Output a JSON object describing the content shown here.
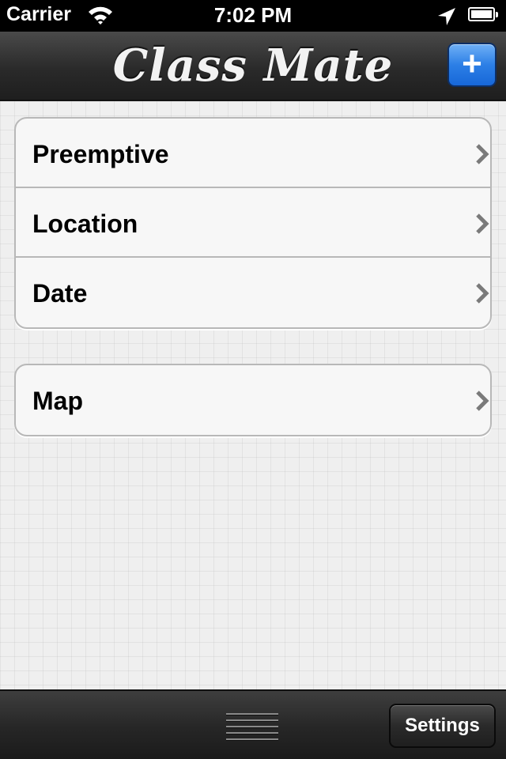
{
  "status_bar": {
    "carrier": "Carrier",
    "time": "7:02 PM",
    "icons": [
      "wifi-icon",
      "location-arrow-icon",
      "battery-icon"
    ]
  },
  "nav_bar": {
    "title": "Class Mate",
    "add_button_label": "+"
  },
  "groups": [
    {
      "rows": [
        {
          "label": "Preemptive",
          "icon": "chevron-right-icon"
        },
        {
          "label": "Location",
          "icon": "chevron-right-icon"
        },
        {
          "label": "Date",
          "icon": "chevron-right-icon"
        }
      ]
    },
    {
      "rows": [
        {
          "label": "Map",
          "icon": "chevron-right-icon"
        }
      ]
    }
  ],
  "tab_bar": {
    "handle_icon": "drag-handle-icon",
    "settings_label": "Settings"
  },
  "colors": {
    "accent_blue": "#2c7fe6",
    "bar_dark": "#262626",
    "cell_bg": "#f7f7f7"
  }
}
